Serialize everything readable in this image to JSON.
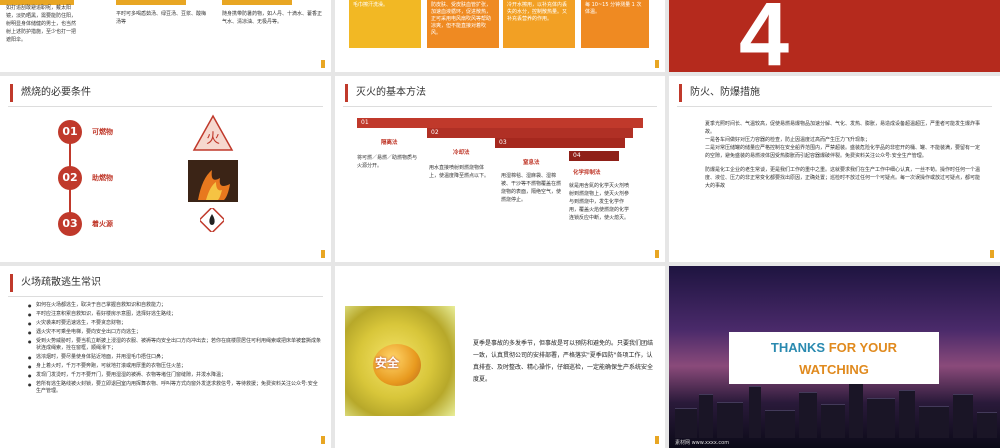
{
  "slides": {
    "s1": {
      "col1": "如打追刮敢避追职呢，戴太阳镜，淡奶晒黑，需要能防住阳，射明显身体储健的男士，也当然射上述防护措施，至少也打一把遮阳伞。",
      "col2": "平时可多喝盾茹汤、绿豆汤、豆浆、酸梅汤等",
      "col3": "随身携带防暑药物，如人丹、十滴水、藿香正气水、清凉油、无极丹等。"
    },
    "s2": {
      "b1": "毛巾擦汗洗澡。",
      "b2": "防皮肤、受皮肤血管扩张，加速血液循环，促进散热，正可采用电风扇吹风等帮助凉爽，但不能直接对着吹风。",
      "b3": "冷开水擦用，以补充体内丢失的水分，控制散热量。又补充丢营养的作用。",
      "b4": "每 10~15 分钟测量 1 次体温。"
    },
    "s3": {
      "big": "4"
    },
    "s4": {
      "title": "燃烧的必要条件",
      "items": [
        {
          "num": "01",
          "label": "可燃物"
        },
        {
          "num": "02",
          "label": "助燃物"
        },
        {
          "num": "03",
          "label": "着火源"
        }
      ],
      "tri_char": "火"
    },
    "s5": {
      "title": "灭火的基本方法",
      "cols": [
        {
          "num": "01",
          "name": "隔离法",
          "text": "将可燃／易燃／助燃物质与火源分开。"
        },
        {
          "num": "02",
          "name": "冷却法",
          "text": "用水直接喷射到燃烧物体上，使温度降至燃点以下。"
        },
        {
          "num": "03",
          "name": "窒息法",
          "text": "用湿棉毯、湿麻袋、湿棉被、干沙等不燃物覆盖在燃烧物的表面，隔绝空气，使燃烧停止。"
        },
        {
          "num": "04",
          "name": "化学抑制法",
          "text": "就是用含氮的化学灭火剂喷射到燃烧物上，使灭火剂参与到燃烧中，发生化学作用，覆盖火焰使燃烧的化学连锁反应中断，使火熄灭。"
        }
      ]
    },
    "s6": {
      "title": "防火、防爆措施",
      "p1": "夏季光照时间长、气温较高，促使易燃易爆物品加速分解、气化、发热、膨胀，易造成设备超温超压，严重者可能发生爆炸事故。",
      "p2": "一是各车间做好对压力容器的检查，防止因温度过高而产生压力飞升现象；",
      "p3": "二是对常压储罐的储量应严格控制在安全船界范围内，严禁超装。盛装危险化学品的非密开的桶、罐、不能装满，要留有一定的空隙，避免盛装的易燃液体因受热膨胀而引起容器爆破伴裂。免费资料关注公众号:安全生产管理。",
      "p4": "防爆是化工企业的老生常谈，更是我们工作的重中之重。这就要求我们在生产工作中细心认真，一丝不苟。操作时任何一个温度、液位、压力的非正常变化都要找出原因，正确处置；巡检时不放过任何一个可疑点。每一次误操作或放过可疑点，都可能大的事故"
    },
    "s7": {
      "title": "火场疏散逃生常识",
      "items": [
        "如何在火场都逃生，取决于自己掌握自救知识和自救能力；",
        "平时应注意积累自救知识，看好楼房示意图，选择好逃生路线；",
        "火灾袭来时要迅速逃生，不要贪恋财物；",
        "遇火灾不可乘坐电梯，要向安全出口方向逃生；",
        "受到火势威胁时，要当机立断披上浸湿的衣服、被褥等向安全出口方向冲出去；若你在底楼层居住可利用绳索或把床单被套撕成条状连成绳索，拴在窗框，顺绳滑下；",
        "逃浓烟时，要尽量使身体贴近地面，并用湿毛巾捂住口鼻；",
        "身上着火时，千万不要奔跑，可就地打滚或用厚重的衣物压住火苗；",
        "发现门发烫时，千万不要开门，要用湿湿的被褥、衣物等堵住门窗缝隙，并泼水降温；",
        "若所有逃生路线被火封锁，要立即退回室内用挥舞衣物、呼叫等方式向窗外发送求救信号，等待救援；免费资料关注公众号:安全生产管理。"
      ]
    },
    "s8": {
      "ball": "安全",
      "text": "夏季是事故的多发季节，但事故是可以预防和避免的。只要我们团结一致，认真贯彻公司的安排部署，严格落实\"夏季四防\"各项工作，认真排查、及时整改、精心操作，仔细巡检，一定能确保生产系统安全度夏。"
    },
    "s9": {
      "line1a": "THANKS ",
      "line1b": "FOR YOUR",
      "line2": "WATCHING",
      "footer": "素材网 www.xxxx.com"
    }
  },
  "colors": {
    "accent": "#c0392b",
    "orange": "#e8a623",
    "teal": "#2a8ab0"
  }
}
